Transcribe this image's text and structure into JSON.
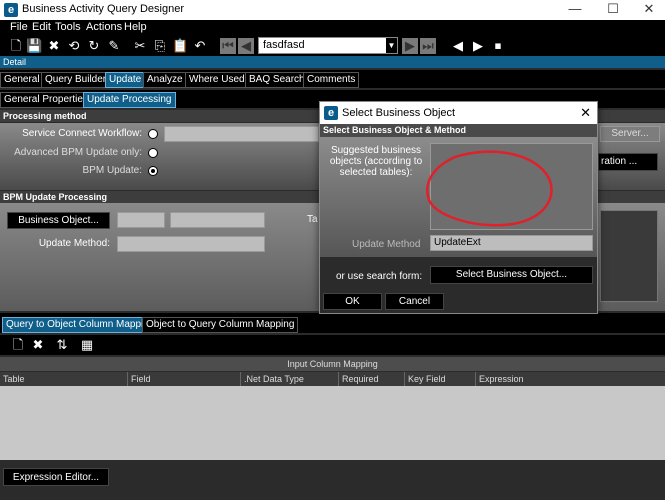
{
  "window": {
    "title": "Business Activity Query Designer"
  },
  "menu": [
    "File",
    "Edit",
    "Tools",
    "Actions",
    "Help"
  ],
  "toolbar": {
    "query_value": "fasdfasd"
  },
  "detail_label": "Detail",
  "tabs": [
    "General",
    "Query Builder",
    "Update",
    "Analyze",
    "Where Used",
    "BAQ Search",
    "Comments"
  ],
  "subtabs": [
    "General Properties",
    "Update Processing"
  ],
  "processing": {
    "header": "Processing method",
    "service_connect": "Service Connect Workflow:",
    "advanced_bpm": "Advanced BPM Update only:",
    "bpm_update": "BPM Update:",
    "server_btn": "Server...",
    "config_btn": "ration ..."
  },
  "bpm": {
    "header": "BPM Update Processing",
    "business_object_btn": "Business Object...",
    "update_method": "Update Method:",
    "ta_label": "Ta"
  },
  "bottom_tabs": [
    "Query to Object Column Mapping",
    "Object to Query Column Mapping"
  ],
  "grid": {
    "title": "Input Column Mapping",
    "columns": [
      "Table",
      "Field",
      ".Net Data Type",
      "Required",
      "Key Field",
      "Expression"
    ]
  },
  "expression_btn": "Expression Editor...",
  "dialog": {
    "title": "Select Business Object",
    "header": "Select Business Object & Method",
    "suggested_label": "Suggested business objects (according to selected tables):",
    "update_method_label": "Update Method",
    "update_method_value": "UpdateExt",
    "search_label": "or use search form:",
    "select_btn": "Select Business Object...",
    "ok": "OK",
    "cancel": "Cancel",
    "annotation_color": "#e0202a"
  }
}
